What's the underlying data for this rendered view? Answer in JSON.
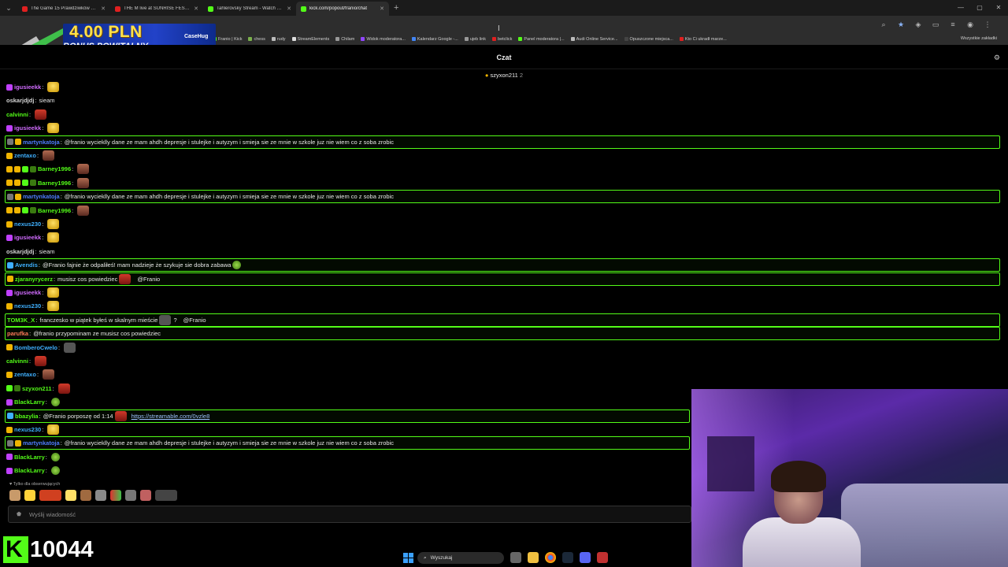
{
  "browser": {
    "tabs": [
      {
        "label": "The Game 15 Prawdziwków vs ...",
        "favicon_color": "#e02020",
        "active": false
      },
      {
        "label": "THE M live at SUNRISE FESTI...",
        "favicon_color": "#e02020",
        "active": false
      },
      {
        "label": "Tahlerovsky Stream - Watch Li...",
        "favicon_color": "#53fc18",
        "active": false
      },
      {
        "label": "kick.com/popout/franio/chat",
        "favicon_color": "#53fc18",
        "active": true
      }
    ],
    "bookmarks": [
      {
        "label": "Franio | Kick",
        "color": "#53fc18"
      },
      {
        "label": "chess",
        "color": "#7bb14c"
      },
      {
        "label": "rudy",
        "color": "#bbbbbb"
      },
      {
        "label": "StreamElements",
        "color": "#dddddd"
      },
      {
        "label": "Chilam",
        "color": "#999999"
      },
      {
        "label": "Widok moderatora...",
        "color": "#9146ff"
      },
      {
        "label": "Kalendarz Google -...",
        "color": "#4285f4"
      },
      {
        "label": "ujeb link",
        "color": "#999999"
      },
      {
        "label": "betclick",
        "color": "#e02020"
      },
      {
        "label": "Panel moderatora |...",
        "color": "#53fc18"
      },
      {
        "label": "Audi Online Service...",
        "color": "#bbbbbb"
      },
      {
        "label": "Opuszczone miejsca...",
        "color": "#444444"
      },
      {
        "label": "Kto Ci ukradł marze...",
        "color": "#e02020"
      }
    ],
    "all_bookmarks_label": "Wszystkie zakładki"
  },
  "promo": {
    "amount": "4.00 PLN",
    "subtitle": "BONUS POWITALNY",
    "brand": "CaseHug"
  },
  "chat": {
    "title": "Czat",
    "pinned_user": "szyxon211",
    "pinned_count": "2",
    "messages": [
      {
        "user": "igusieekk",
        "color": "#d16cff",
        "badges": [
          "#c040ff"
        ],
        "text": "",
        "emotes": [
          "gold"
        ],
        "hl": false
      },
      {
        "user": "oskarjdjdj",
        "color": "#d6d6d6",
        "badges": [],
        "text": "sieam",
        "emotes": [],
        "hl": false
      },
      {
        "user": "calvinni",
        "color": "#53fc18",
        "badges": [],
        "text": "",
        "emotes": [
          "red"
        ],
        "hl": false
      },
      {
        "user": "igusieekk",
        "color": "#d16cff",
        "badges": [
          "#c040ff"
        ],
        "text": "",
        "emotes": [
          "gold"
        ],
        "hl": false
      },
      {
        "user": "martynkatoja",
        "color": "#4f7bff",
        "badges": [
          "#777777",
          "#f0b400"
        ],
        "text": "@franio wycieklly dane ze mam ahdh depresje i stulejke i autyzym i smieja sie ze mnie w szkole juz nie wiem co z soba zrobic",
        "emotes": [],
        "hl": true
      },
      {
        "user": "zentaxo",
        "color": "#3fb0ff",
        "badges": [
          "#f0b400"
        ],
        "text": "",
        "emotes": [
          "face"
        ],
        "hl": false
      },
      {
        "user": "Barney1996",
        "color": "#53fc18",
        "badges": [
          "#f0b400",
          "#f0b400",
          "#53fc18",
          "#3a7a10"
        ],
        "text": "",
        "emotes": [
          "face"
        ],
        "hl": false
      },
      {
        "user": "Barney1996",
        "color": "#53fc18",
        "badges": [
          "#f0b400",
          "#f0b400",
          "#53fc18",
          "#3a7a10"
        ],
        "text": "",
        "emotes": [
          "face"
        ],
        "hl": false
      },
      {
        "user": "martynkatoja",
        "color": "#4f7bff",
        "badges": [
          "#777777",
          "#f0b400"
        ],
        "text": "@franio wycieklly dane ze mam ahdh depresje i stulejke i autyzym i smieja sie ze mnie w szkole juz nie wiem co z soba zrobic",
        "emotes": [],
        "hl": true
      },
      {
        "user": "Barney1996",
        "color": "#53fc18",
        "badges": [
          "#f0b400",
          "#f0b400",
          "#53fc18",
          "#3a7a10"
        ],
        "text": "",
        "emotes": [
          "face"
        ],
        "hl": false
      },
      {
        "user": "nexus230",
        "color": "#3fb0ff",
        "badges": [
          "#f0b400"
        ],
        "text": "",
        "emotes": [
          "gold"
        ],
        "hl": false
      },
      {
        "user": "igusieekk",
        "color": "#d16cff",
        "badges": [
          "#c040ff"
        ],
        "text": "",
        "emotes": [
          "gold"
        ],
        "hl": false
      },
      {
        "user": "oskarjdjdj",
        "color": "#d6d6d6",
        "badges": [],
        "text": "sieam",
        "emotes": [],
        "hl": false
      },
      {
        "user": "Avendis",
        "color": "#3fb0ff",
        "badges": [
          "#3fb0ff"
        ],
        "text": "@Franio fajnie że odpaliłeś! mam nadzieje że szykuje sie dobra zabawa",
        "emotes": [
          "green"
        ],
        "hl": true
      },
      {
        "user": "zjaranyrycerz",
        "color": "#53fc18",
        "badges": [
          "#f0b400"
        ],
        "text": "musisz cos powiedziec",
        "emotes": [
          "red"
        ],
        "mention": "@Franio",
        "hl": true
      },
      {
        "user": "igusieekk",
        "color": "#d16cff",
        "badges": [
          "#c040ff"
        ],
        "text": "",
        "emotes": [
          "gold"
        ],
        "hl": false
      },
      {
        "user": "nexus230",
        "color": "#3fb0ff",
        "badges": [
          "#f0b400"
        ],
        "text": "",
        "emotes": [
          "gold"
        ],
        "hl": false
      },
      {
        "user": "TOM3K_X",
        "color": "#53fc18",
        "badges": [],
        "text": "franczesko w piątek byłeś w skalnym mieście",
        "emotes": [
          "grey"
        ],
        "extra": "?",
        "mention": "@Franio",
        "hl": true
      },
      {
        "user": "parufka",
        "color": "#ff7a5a",
        "badges": [],
        "text": "@franio przypominam ze musisz cos powiedziec",
        "emotes": [],
        "hl": true
      },
      {
        "user": "BomberoCwelo",
        "color": "#3fb0ff",
        "badges": [
          "#f0b400"
        ],
        "text": "",
        "emotes": [
          "grey"
        ],
        "hl": false
      },
      {
        "user": "calvinni",
        "color": "#53fc18",
        "badges": [],
        "text": "",
        "emotes": [
          "red"
        ],
        "hl": false
      },
      {
        "user": "zentaxo",
        "color": "#3fb0ff",
        "badges": [
          "#f0b400"
        ],
        "text": "",
        "emotes": [
          "face"
        ],
        "hl": false
      },
      {
        "user": "szyxon211",
        "color": "#53fc18",
        "badges": [
          "#53fc18",
          "#3a7a10"
        ],
        "text": "",
        "emotes": [
          "red"
        ],
        "hl": false
      },
      {
        "user": "BlackLarry",
        "color": "#53fc18",
        "badges": [
          "#c040ff"
        ],
        "text": "",
        "emotes": [
          "green"
        ],
        "hl": false
      },
      {
        "user": "bbazylia",
        "color": "#53fc18",
        "badges": [
          "#3fb0ff"
        ],
        "text": "@Franio porposzę od 1:14",
        "emotes": [
          "red"
        ],
        "link": "https://streamable.com/0vzle8",
        "hl": true
      },
      {
        "user": "nexus230",
        "color": "#3fb0ff",
        "badges": [
          "#f0b400"
        ],
        "text": "",
        "emotes": [
          "gold"
        ],
        "hl": false
      },
      {
        "user": "martynkatoja",
        "color": "#4f7bff",
        "badges": [
          "#777777",
          "#f0b400"
        ],
        "text": "@franio wycieklly dane ze mam ahdh depresje i stulejke i autyzym i smieja sie ze mnie w szkole juz nie wiem co z soba zrobic",
        "emotes": [],
        "hl": true
      },
      {
        "user": "BlackLarry",
        "color": "#53fc18",
        "badges": [
          "#c040ff"
        ],
        "text": "",
        "emotes": [
          "green"
        ],
        "hl": false
      },
      {
        "user": "BlackLarry",
        "color": "#53fc18",
        "badges": [
          "#c040ff"
        ],
        "text": "",
        "emotes": [
          "green"
        ],
        "hl": false
      }
    ],
    "followers_only_label": "Tylko dla obserwujących",
    "input_placeholder": "Wyślij wiadomość"
  },
  "overlay": {
    "follower_count": "10044"
  },
  "taskbar": {
    "search_label": "Wyszukaj"
  }
}
